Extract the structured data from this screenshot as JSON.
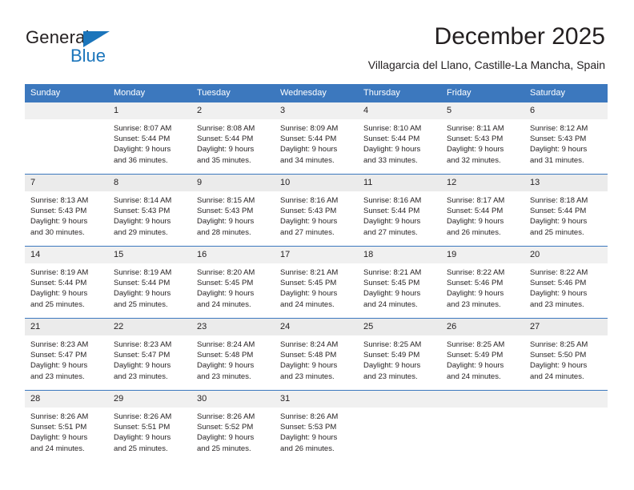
{
  "brand": {
    "name_part1": "General",
    "name_part2": "Blue",
    "triangle_color": "#1b75bb"
  },
  "header": {
    "title": "December 2025",
    "subtitle": "Villagarcia del Llano, Castille-La Mancha, Spain",
    "accent_color": "#3c78be"
  },
  "weekdays": [
    "Sunday",
    "Monday",
    "Tuesday",
    "Wednesday",
    "Thursday",
    "Friday",
    "Saturday"
  ],
  "weeks": [
    [
      {
        "day": "",
        "blank": true,
        "sunrise": "",
        "sunset": "",
        "daylight1": "",
        "daylight2": ""
      },
      {
        "day": "1",
        "sunrise": "Sunrise: 8:07 AM",
        "sunset": "Sunset: 5:44 PM",
        "daylight1": "Daylight: 9 hours",
        "daylight2": "and 36 minutes."
      },
      {
        "day": "2",
        "sunrise": "Sunrise: 8:08 AM",
        "sunset": "Sunset: 5:44 PM",
        "daylight1": "Daylight: 9 hours",
        "daylight2": "and 35 minutes."
      },
      {
        "day": "3",
        "sunrise": "Sunrise: 8:09 AM",
        "sunset": "Sunset: 5:44 PM",
        "daylight1": "Daylight: 9 hours",
        "daylight2": "and 34 minutes."
      },
      {
        "day": "4",
        "sunrise": "Sunrise: 8:10 AM",
        "sunset": "Sunset: 5:44 PM",
        "daylight1": "Daylight: 9 hours",
        "daylight2": "and 33 minutes."
      },
      {
        "day": "5",
        "sunrise": "Sunrise: 8:11 AM",
        "sunset": "Sunset: 5:43 PM",
        "daylight1": "Daylight: 9 hours",
        "daylight2": "and 32 minutes."
      },
      {
        "day": "6",
        "sunrise": "Sunrise: 8:12 AM",
        "sunset": "Sunset: 5:43 PM",
        "daylight1": "Daylight: 9 hours",
        "daylight2": "and 31 minutes."
      }
    ],
    [
      {
        "day": "7",
        "sunrise": "Sunrise: 8:13 AM",
        "sunset": "Sunset: 5:43 PM",
        "daylight1": "Daylight: 9 hours",
        "daylight2": "and 30 minutes."
      },
      {
        "day": "8",
        "sunrise": "Sunrise: 8:14 AM",
        "sunset": "Sunset: 5:43 PM",
        "daylight1": "Daylight: 9 hours",
        "daylight2": "and 29 minutes."
      },
      {
        "day": "9",
        "sunrise": "Sunrise: 8:15 AM",
        "sunset": "Sunset: 5:43 PM",
        "daylight1": "Daylight: 9 hours",
        "daylight2": "and 28 minutes."
      },
      {
        "day": "10",
        "sunrise": "Sunrise: 8:16 AM",
        "sunset": "Sunset: 5:43 PM",
        "daylight1": "Daylight: 9 hours",
        "daylight2": "and 27 minutes."
      },
      {
        "day": "11",
        "sunrise": "Sunrise: 8:16 AM",
        "sunset": "Sunset: 5:44 PM",
        "daylight1": "Daylight: 9 hours",
        "daylight2": "and 27 minutes."
      },
      {
        "day": "12",
        "sunrise": "Sunrise: 8:17 AM",
        "sunset": "Sunset: 5:44 PM",
        "daylight1": "Daylight: 9 hours",
        "daylight2": "and 26 minutes."
      },
      {
        "day": "13",
        "sunrise": "Sunrise: 8:18 AM",
        "sunset": "Sunset: 5:44 PM",
        "daylight1": "Daylight: 9 hours",
        "daylight2": "and 25 minutes."
      }
    ],
    [
      {
        "day": "14",
        "sunrise": "Sunrise: 8:19 AM",
        "sunset": "Sunset: 5:44 PM",
        "daylight1": "Daylight: 9 hours",
        "daylight2": "and 25 minutes."
      },
      {
        "day": "15",
        "sunrise": "Sunrise: 8:19 AM",
        "sunset": "Sunset: 5:44 PM",
        "daylight1": "Daylight: 9 hours",
        "daylight2": "and 25 minutes."
      },
      {
        "day": "16",
        "sunrise": "Sunrise: 8:20 AM",
        "sunset": "Sunset: 5:45 PM",
        "daylight1": "Daylight: 9 hours",
        "daylight2": "and 24 minutes."
      },
      {
        "day": "17",
        "sunrise": "Sunrise: 8:21 AM",
        "sunset": "Sunset: 5:45 PM",
        "daylight1": "Daylight: 9 hours",
        "daylight2": "and 24 minutes."
      },
      {
        "day": "18",
        "sunrise": "Sunrise: 8:21 AM",
        "sunset": "Sunset: 5:45 PM",
        "daylight1": "Daylight: 9 hours",
        "daylight2": "and 24 minutes."
      },
      {
        "day": "19",
        "sunrise": "Sunrise: 8:22 AM",
        "sunset": "Sunset: 5:46 PM",
        "daylight1": "Daylight: 9 hours",
        "daylight2": "and 23 minutes."
      },
      {
        "day": "20",
        "sunrise": "Sunrise: 8:22 AM",
        "sunset": "Sunset: 5:46 PM",
        "daylight1": "Daylight: 9 hours",
        "daylight2": "and 23 minutes."
      }
    ],
    [
      {
        "day": "21",
        "sunrise": "Sunrise: 8:23 AM",
        "sunset": "Sunset: 5:47 PM",
        "daylight1": "Daylight: 9 hours",
        "daylight2": "and 23 minutes."
      },
      {
        "day": "22",
        "sunrise": "Sunrise: 8:23 AM",
        "sunset": "Sunset: 5:47 PM",
        "daylight1": "Daylight: 9 hours",
        "daylight2": "and 23 minutes."
      },
      {
        "day": "23",
        "sunrise": "Sunrise: 8:24 AM",
        "sunset": "Sunset: 5:48 PM",
        "daylight1": "Daylight: 9 hours",
        "daylight2": "and 23 minutes."
      },
      {
        "day": "24",
        "sunrise": "Sunrise: 8:24 AM",
        "sunset": "Sunset: 5:48 PM",
        "daylight1": "Daylight: 9 hours",
        "daylight2": "and 23 minutes."
      },
      {
        "day": "25",
        "sunrise": "Sunrise: 8:25 AM",
        "sunset": "Sunset: 5:49 PM",
        "daylight1": "Daylight: 9 hours",
        "daylight2": "and 23 minutes."
      },
      {
        "day": "26",
        "sunrise": "Sunrise: 8:25 AM",
        "sunset": "Sunset: 5:49 PM",
        "daylight1": "Daylight: 9 hours",
        "daylight2": "and 24 minutes."
      },
      {
        "day": "27",
        "sunrise": "Sunrise: 8:25 AM",
        "sunset": "Sunset: 5:50 PM",
        "daylight1": "Daylight: 9 hours",
        "daylight2": "and 24 minutes."
      }
    ],
    [
      {
        "day": "28",
        "sunrise": "Sunrise: 8:26 AM",
        "sunset": "Sunset: 5:51 PM",
        "daylight1": "Daylight: 9 hours",
        "daylight2": "and 24 minutes."
      },
      {
        "day": "29",
        "sunrise": "Sunrise: 8:26 AM",
        "sunset": "Sunset: 5:51 PM",
        "daylight1": "Daylight: 9 hours",
        "daylight2": "and 25 minutes."
      },
      {
        "day": "30",
        "sunrise": "Sunrise: 8:26 AM",
        "sunset": "Sunset: 5:52 PM",
        "daylight1": "Daylight: 9 hours",
        "daylight2": "and 25 minutes."
      },
      {
        "day": "31",
        "sunrise": "Sunrise: 8:26 AM",
        "sunset": "Sunset: 5:53 PM",
        "daylight1": "Daylight: 9 hours",
        "daylight2": "and 26 minutes."
      },
      {
        "day": "",
        "blank": true,
        "sunrise": "",
        "sunset": "",
        "daylight1": "",
        "daylight2": ""
      },
      {
        "day": "",
        "blank": true,
        "sunrise": "",
        "sunset": "",
        "daylight1": "",
        "daylight2": ""
      },
      {
        "day": "",
        "blank": true,
        "sunrise": "",
        "sunset": "",
        "daylight1": "",
        "daylight2": ""
      }
    ]
  ]
}
